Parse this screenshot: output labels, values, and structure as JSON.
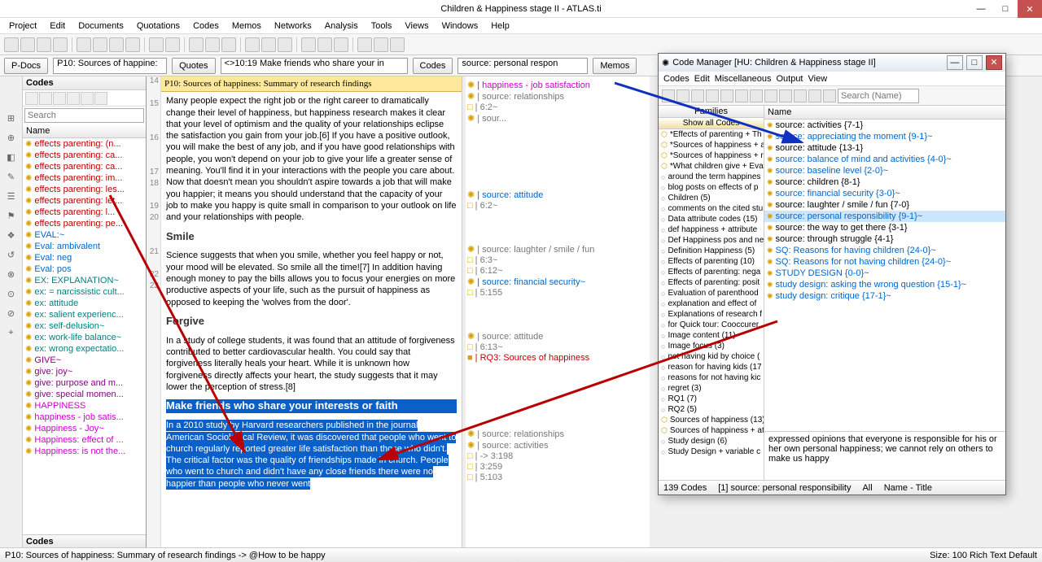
{
  "window": {
    "title": "Children & Happiness stage II - ATLAS.ti",
    "min": "—",
    "max": "□",
    "close": "✕"
  },
  "menubar": [
    "Project",
    "Edit",
    "Documents",
    "Quotations",
    "Codes",
    "Memos",
    "Networks",
    "Analysis",
    "Tools",
    "Views",
    "Windows",
    "Help"
  ],
  "dropdownbar": {
    "pdocs_btn": "P-Docs",
    "pdocs_val": "P10: Sources of happine:",
    "quotes_btn": "Quotes",
    "quotes_val": "<>10:19 Make friends who share your in",
    "codes_btn": "Codes",
    "codes_val": "source: personal respon",
    "memos_btn": "Memos"
  },
  "codes_panel": {
    "title": "Codes",
    "search_ph": "Search",
    "col": "Name",
    "footer": "Codes",
    "items": [
      {
        "t": "effects parenting: (n...",
        "c": "red"
      },
      {
        "t": "effects parenting: ca...",
        "c": "red"
      },
      {
        "t": "effects parenting: ca...",
        "c": "red"
      },
      {
        "t": "effects parenting: im...",
        "c": "red"
      },
      {
        "t": "effects parenting: les...",
        "c": "red"
      },
      {
        "t": "effects parenting: let...",
        "c": "red"
      },
      {
        "t": "effects parenting: l...",
        "c": "red"
      },
      {
        "t": "effects parenting: pe...",
        "c": "red"
      },
      {
        "t": "EVAL:~",
        "c": "blue"
      },
      {
        "t": "Eval: ambivalent",
        "c": "blue"
      },
      {
        "t": "Eval: neg",
        "c": "blue"
      },
      {
        "t": "Eval: pos",
        "c": "blue"
      },
      {
        "t": "EX:  EXPLANATION~",
        "c": "teal"
      },
      {
        "t": "ex: = narcissistic cult...",
        "c": "teal"
      },
      {
        "t": "ex: attitude",
        "c": "teal"
      },
      {
        "t": "ex: salient experienc...",
        "c": "teal"
      },
      {
        "t": "ex: self-delusion~",
        "c": "teal"
      },
      {
        "t": "ex: work-life balance~",
        "c": "teal"
      },
      {
        "t": "ex: wrong expectatio...",
        "c": "teal"
      },
      {
        "t": "GIVE~",
        "c": "pur"
      },
      {
        "t": "give: joy~",
        "c": "pur"
      },
      {
        "t": "give: purpose and m...",
        "c": "pur"
      },
      {
        "t": "give: special momen...",
        "c": "pur"
      },
      {
        "t": "HAPPINESS",
        "c": "mag"
      },
      {
        "t": "happiness - job satis...",
        "c": "mag"
      },
      {
        "t": "Happiness - Joy~",
        "c": "mag"
      },
      {
        "t": "Happiness: effect of ...",
        "c": "mag"
      },
      {
        "t": "Happiness: is not the...",
        "c": "mag"
      }
    ]
  },
  "doc": {
    "title_bar": "P10: Sources of happiness: Summary of research findings",
    "p1": "Many people expect the right job or the right career to dramatically change their level of happiness, but happiness research makes it clear that your level of optimism and the quality of your relationships eclipse the satisfaction you gain from your job.[6] If you have a positive outlook, you will make the best of any job, and if you have good relationships with people, you won't depend on your job to give your life a greater sense of meaning. You'll find it in your interactions with the people you care about. Now that doesn't mean you shouldn't aspire towards a job that will make you happier; it means you should understand that the capacity of your job to make you happy is quite small in comparison to your outlook on life and your relationships with people.",
    "h2": "Smile",
    "p2": "Science suggests that when you smile, whether you feel happy or not, your mood will be elevated. So smile all the time![7] In addition having enough money to pay the bills allows you to focus your energies on more productive aspects of your life, such as the pursuit of happiness as opposed to keeping the 'wolves from the door'.",
    "h3": "Forgive",
    "p3": "In a study of college students, it was found that an attitude of forgiveness contributed to better cardiovascular health. You could say that forgiveness literally heals your heart. While it is unknown how forgiveness directly affects your heart, the study suggests that it may lower the perception of stress.[8]",
    "h4_sel": "Make friends who share your interests or faith",
    "p4_sel": "In a 2010 study by Harvard researchers published in the journal American Sociological Review, it was discovered that people who went to church regularly reported greater life satisfaction than those who didn't. The critical factor was the quality of friendships made in church. People who went to church and didn't have any close friends there were no happier than people who never went"
  },
  "gutter": [
    "14",
    "",
    "15",
    "",
    "",
    "16",
    "",
    "",
    "17",
    "18",
    "",
    "19",
    "20",
    "",
    "",
    "21",
    "",
    "22",
    "23"
  ],
  "margin": [
    {
      "t": "| happiness - job satisfaction",
      "c": "mag",
      "ic": "✺"
    },
    {
      "t": "| source: relationships",
      "c": "gray",
      "ic": "✺"
    },
    {
      "t": "| <supports>  6:2~",
      "c": "gray",
      "ic": "□"
    },
    {
      "t": "| sour...",
      "c": "gray",
      "ic": "✺",
      "sp": true
    },
    {
      "t": "",
      "sp": true,
      "h": "mspace-lg"
    },
    {
      "t": "| source: attitude",
      "c": "blue",
      "ic": "✺"
    },
    {
      "t": "| <supports>  6:2~",
      "c": "gray",
      "ic": "□"
    },
    {
      "t": "",
      "sp": true,
      "h": "mspace"
    },
    {
      "t": "| source: laughter / smile / fun",
      "c": "gray",
      "ic": "✺"
    },
    {
      "t": "| <supports>  6:3~",
      "c": "gray",
      "ic": "□"
    },
    {
      "t": "| 6:12~  <supports>",
      "c": "gray",
      "ic": "□"
    },
    {
      "t": "| source: financial security~",
      "c": "blue",
      "ic": "✺"
    },
    {
      "t": "| <contradicts>  5:155",
      "c": "gray",
      "ic": "□"
    },
    {
      "t": "",
      "sp": true,
      "h": "mspace"
    },
    {
      "t": "| source: attitude",
      "c": "gray",
      "ic": "✺"
    },
    {
      "t": "| <supports>  6:13~",
      "c": "gray",
      "ic": "□"
    },
    {
      "t": "| RQ3: Sources of happiness",
      "c": "red",
      "ic": "■"
    },
    {
      "t": "",
      "sp": true,
      "h": "mspace-lg"
    },
    {
      "t": "| source: relationships",
      "c": "gray",
      "ic": "✺"
    },
    {
      "t": "| source: activities",
      "c": "gray",
      "ic": "✺"
    },
    {
      "t": "| <contradicts>->  3:198",
      "c": "gray",
      "ic": "□"
    },
    {
      "t": "| 3:259  <contradicts>",
      "c": "gray",
      "ic": "□"
    },
    {
      "t": "| 5:103  <contradicts>",
      "c": "gray",
      "ic": "□"
    }
  ],
  "cm": {
    "title": "Code Manager [HU: Children & Happiness stage II]",
    "menu": [
      "Codes",
      "Edit",
      "Miscellaneous",
      "Output",
      "View"
    ],
    "search_ph": "Search (Name)",
    "fam_hdr": "Families",
    "fam_sub": "Show all Codes",
    "families": [
      {
        "t": "*Effects of parenting + Th",
        "c": "y"
      },
      {
        "t": "*Sources of happiness + a",
        "c": "y"
      },
      {
        "t": "*Sources of happiness + r",
        "c": "y"
      },
      {
        "t": "*What children give + Eva",
        "c": "y"
      },
      {
        "t": "around the term happines",
        "c": "g"
      },
      {
        "t": "blog posts on effects of p",
        "c": "g"
      },
      {
        "t": "Children (5)",
        "c": "g"
      },
      {
        "t": "comments on the cited stu",
        "c": "g"
      },
      {
        "t": "Data attribute codes (15)",
        "c": "g"
      },
      {
        "t": "def happiness + attribute",
        "c": "g"
      },
      {
        "t": "Def Happiness pos and ne",
        "c": "g"
      },
      {
        "t": "Definition Happiness (5)",
        "c": "g"
      },
      {
        "t": "Effects of parenting (10)",
        "c": "g"
      },
      {
        "t": "Effects of parenting: nega",
        "c": "g"
      },
      {
        "t": "Effects of parenting: posit",
        "c": "g"
      },
      {
        "t": "Evaluation of parenthood",
        "c": "g"
      },
      {
        "t": "explanation and effect of",
        "c": "g"
      },
      {
        "t": "Explanations of research f",
        "c": "g"
      },
      {
        "t": "for Quick tour: Cooccurer",
        "c": "g"
      },
      {
        "t": "Image content (11)",
        "c": "g"
      },
      {
        "t": "Image focus (3)",
        "c": "g"
      },
      {
        "t": "not having kid by choice (",
        "c": "g"
      },
      {
        "t": "reason for having kids (17",
        "c": "g"
      },
      {
        "t": "reasons for not having kic",
        "c": "g"
      },
      {
        "t": "regret (3)",
        "c": "g"
      },
      {
        "t": "RQ1 (7)",
        "c": "g"
      },
      {
        "t": "RQ2 (5)",
        "c": "g"
      },
      {
        "t": "Sources of happiness (13)",
        "c": "y"
      },
      {
        "t": "Sources of happiness + at",
        "c": "y"
      },
      {
        "t": "Study design (6)",
        "c": "g"
      },
      {
        "t": "Study Design + variable c",
        "c": "g"
      }
    ],
    "code_hdr": "Name",
    "codes": [
      {
        "t": "source: activities {7-1}"
      },
      {
        "t": "source: appreciating the moment {9-1}~",
        "c": "blue"
      },
      {
        "t": "source: attitude {13-1}"
      },
      {
        "t": "source: balance of mind and activities {4-0}~",
        "c": "blue"
      },
      {
        "t": "source: baseline level {2-0}~",
        "c": "blue"
      },
      {
        "t": "source: children {8-1}"
      },
      {
        "t": "source: financial security {3-0}~",
        "c": "blue"
      },
      {
        "t": "source: laughter / smile / fun {7-0}"
      },
      {
        "t": "source: personal responsibility {9-1}~",
        "c": "blue",
        "sel": true
      },
      {
        "t": "source: the way to get there {3-1}"
      },
      {
        "t": "source: through struggle {4-1}"
      },
      {
        "t": "SQ: Reasons for having children {24-0}~",
        "c": "blue"
      },
      {
        "t": "SQ: Reasons for not having children {24-0}~",
        "c": "blue"
      },
      {
        "t": "STUDY DESIGN {0-0}~",
        "c": "blue"
      },
      {
        "t": "study design: asking the wrong question {15-1}~",
        "c": "blue"
      },
      {
        "t": "study design: critique {17-1}~",
        "c": "blue"
      }
    ],
    "desc": "expressed opinions that everyone is responsible for his or her own personal happiness; we cannot rely on others to make us happy",
    "status": {
      "count": "139 Codes",
      "sel": "[1] source: personal responsibility",
      "filter": "All",
      "cols": "Name - Title"
    }
  },
  "statusbar": {
    "left": "P10: Sources of happiness: Summary of research findings -> @How to be happy",
    "right": "Size: 100   Rich Text   Default"
  }
}
